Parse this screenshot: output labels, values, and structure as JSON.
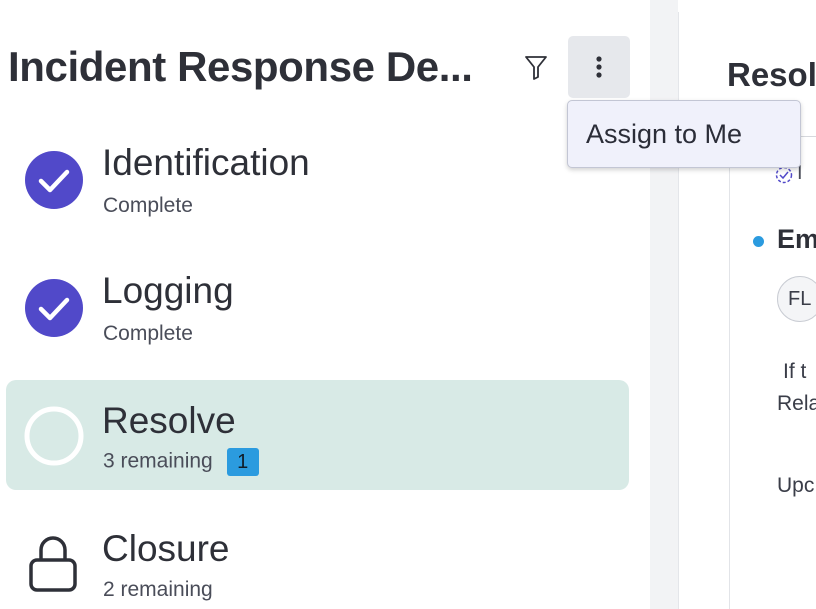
{
  "header": {
    "title": "Incident Response De...",
    "filter_icon": "filter-icon",
    "more_icon": "more-vertical-icon"
  },
  "tooltip": {
    "label": "Assign to Me"
  },
  "steps": [
    {
      "label": "Identification",
      "status": "Complete",
      "icon": "check-circle-icon"
    },
    {
      "label": "Logging",
      "status": "Complete",
      "icon": "check-circle-icon"
    },
    {
      "label": "Resolve",
      "status": "3 remaining",
      "badge": "1",
      "icon": "empty-circle-icon",
      "active": true
    },
    {
      "label": "Closure",
      "status": "2 remaining",
      "icon": "lock-icon"
    }
  ],
  "detail": {
    "title": "Resol",
    "checked_text": "I",
    "item_title": "Em",
    "avatar_initials": "FL",
    "text_line1": "If t",
    "text_line2": "Rela",
    "text_line3": "Upc"
  },
  "colors": {
    "accent": "#5149c9",
    "active_bg": "#d8eae6",
    "badge_bg": "#2b9bdf",
    "tooltip_bg": "#f0f1fb"
  }
}
